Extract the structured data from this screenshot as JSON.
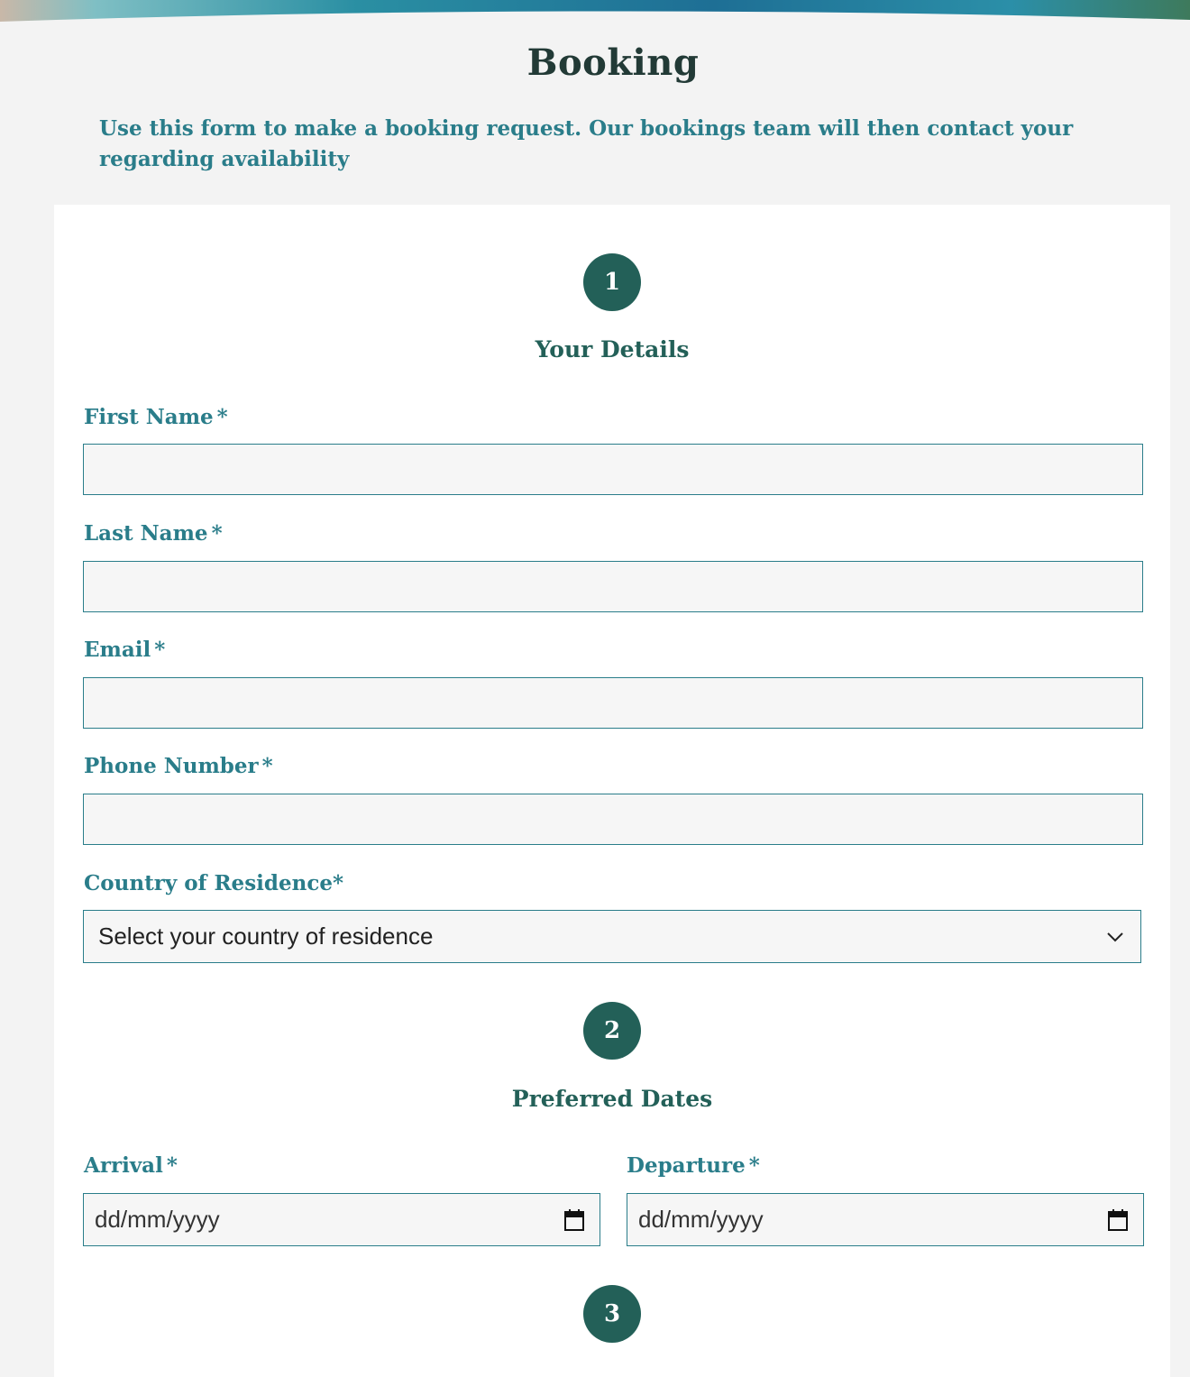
{
  "page": {
    "title": "Booking",
    "intro": "Use this form to make a booking request. Our bookings team will then contact your regarding availability"
  },
  "steps": [
    {
      "number": "1",
      "title": "Your Details"
    },
    {
      "number": "2",
      "title": "Preferred Dates"
    },
    {
      "number": "3"
    }
  ],
  "details": {
    "first_name_label": "First Name",
    "last_name_label": "Last Name",
    "email_label": "Email",
    "phone_label": "Phone Number",
    "country_label": "Country of Residence*",
    "country_selected": "Select your country of residence",
    "required_mark": "*"
  },
  "dates": {
    "arrival_label": "Arrival",
    "departure_label": "Departure",
    "arrival_value": "dd/mm/yyyy",
    "departure_value": "dd/mm/yyyy"
  },
  "colors": {
    "accent": "#2a7d8a",
    "step_circle": "#236058",
    "heading": "#223a36",
    "background": "#f3f3f3"
  }
}
